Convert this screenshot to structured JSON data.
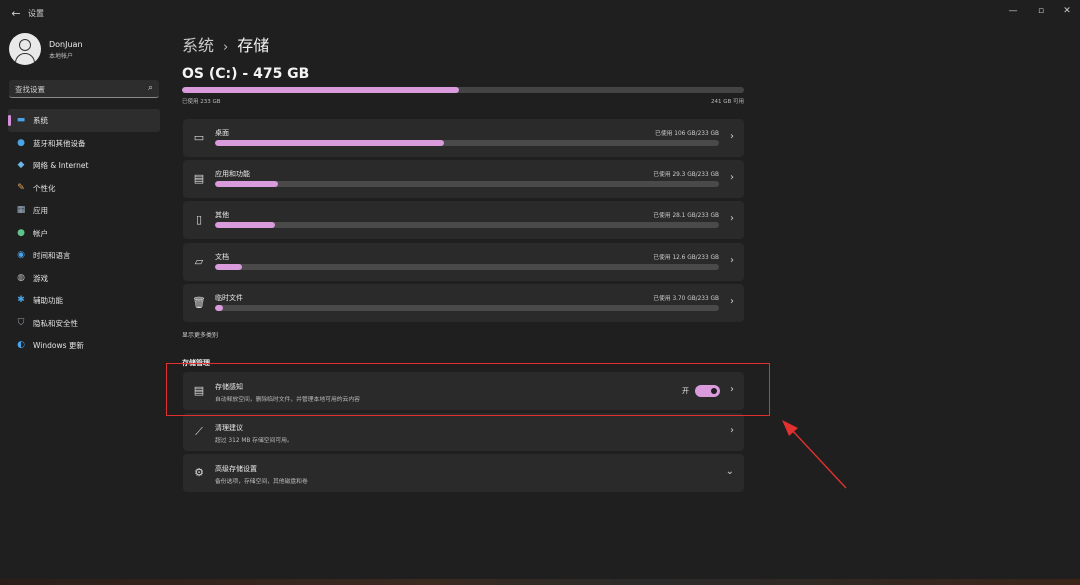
{
  "window": {
    "back_icon": "back-arrow-icon",
    "title": "设置",
    "controls": {
      "minimize": "—",
      "maximize": "▫",
      "close": "✕"
    }
  },
  "profile": {
    "name": "DonJuan",
    "account_type": "本地帐户"
  },
  "search": {
    "placeholder": "查找设置",
    "icon": "search-icon"
  },
  "sidebar": {
    "items": [
      {
        "label": "系统",
        "icon": "system-icon",
        "active": true
      },
      {
        "label": "蓝牙和其他设备",
        "icon": "bluetooth-icon"
      },
      {
        "label": "网络 & Internet",
        "icon": "network-icon"
      },
      {
        "label": "个性化",
        "icon": "personalization-icon"
      },
      {
        "label": "应用",
        "icon": "apps-icon"
      },
      {
        "label": "帐户",
        "icon": "account-icon"
      },
      {
        "label": "时间和语言",
        "icon": "time-language-icon"
      },
      {
        "label": "游戏",
        "icon": "gaming-icon"
      },
      {
        "label": "辅助功能",
        "icon": "accessibility-icon"
      },
      {
        "label": "隐私和安全性",
        "icon": "privacy-icon"
      },
      {
        "label": "Windows 更新",
        "icon": "windows-update-icon"
      }
    ]
  },
  "breadcrumb": {
    "parent": "系统",
    "separator": "›",
    "current": "存储"
  },
  "drive": {
    "title": "OS (C:) - 475 GB",
    "used_label": "已使用 233 GB",
    "free_label": "241 GB 可用",
    "used_fraction": 0.492,
    "accent": "#d99bdc"
  },
  "categories": [
    {
      "name": "桌面",
      "usage": "已使用 106 GB/233 GB",
      "fraction": 0.455,
      "icon": "monitor-icon"
    },
    {
      "name": "应用和功能",
      "usage": "已使用 29.3 GB/233 GB",
      "fraction": 0.125,
      "icon": "apps-features-icon"
    },
    {
      "name": "其他",
      "usage": "已使用 28.1 GB/233 GB",
      "fraction": 0.12,
      "icon": "other-files-icon"
    },
    {
      "name": "文档",
      "usage": "已使用 12.6 GB/233 GB",
      "fraction": 0.054,
      "icon": "folder-icon"
    },
    {
      "name": "临时文件",
      "usage": "已使用 3.70 GB/233 GB",
      "fraction": 0.016,
      "icon": "trash-icon"
    }
  ],
  "show_more": "显示更多类别",
  "management": {
    "section_title": "存储管理",
    "storage_sense": {
      "title": "存储感知",
      "description": "自动释放空间，删除临时文件，并管理本地可用的云内容",
      "state_label": "开",
      "enabled": true,
      "icon": "storage-icon"
    },
    "cleanup": {
      "title": "清理建议",
      "description": "超过 312 MB 存储空间可用。",
      "icon": "broom-icon"
    },
    "advanced": {
      "title": "高级存储设置",
      "description": "备份选项，存储空间，其他磁盘和卷",
      "icon": "gear-icon"
    }
  },
  "annotation": {
    "highlight_color": "#e03030"
  }
}
